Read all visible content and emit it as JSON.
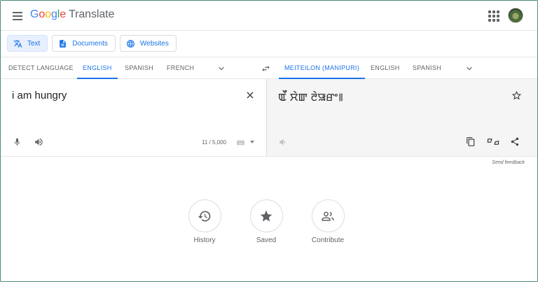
{
  "header": {
    "brand_letters": [
      "G",
      "o",
      "o",
      "g",
      "l",
      "e"
    ],
    "brand_product": "Translate"
  },
  "modes": [
    {
      "label": "Text",
      "icon": "translate-icon",
      "active": true
    },
    {
      "label": "Documents",
      "icon": "document-icon",
      "active": false
    },
    {
      "label": "Websites",
      "icon": "globe-icon",
      "active": false
    }
  ],
  "source_languages": [
    "DETECT LANGUAGE",
    "ENGLISH",
    "SPANISH",
    "FRENCH"
  ],
  "source_active": "ENGLISH",
  "target_languages": [
    "MEITEILON (MANIPURI)",
    "ENGLISH",
    "SPANISH"
  ],
  "target_active": "MEITEILON (MANIPURI)",
  "source": {
    "text": "i am hungry",
    "char_count": "11 / 5,000"
  },
  "target": {
    "text": "ꯑꯩ ꯆꯥꯛ ꯂꯥꯎꯔꯦ꯫"
  },
  "feedback_label": "Send feedback",
  "actions": [
    {
      "label": "History",
      "icon": "history-icon"
    },
    {
      "label": "Saved",
      "icon": "star-icon"
    },
    {
      "label": "Contribute",
      "icon": "people-icon"
    }
  ],
  "colors": {
    "accent": "#1a73e8",
    "active_mode_bg": "#e8f0fe",
    "target_panel_bg": "#f5f5f5",
    "icon_gray": "#5f6368"
  }
}
